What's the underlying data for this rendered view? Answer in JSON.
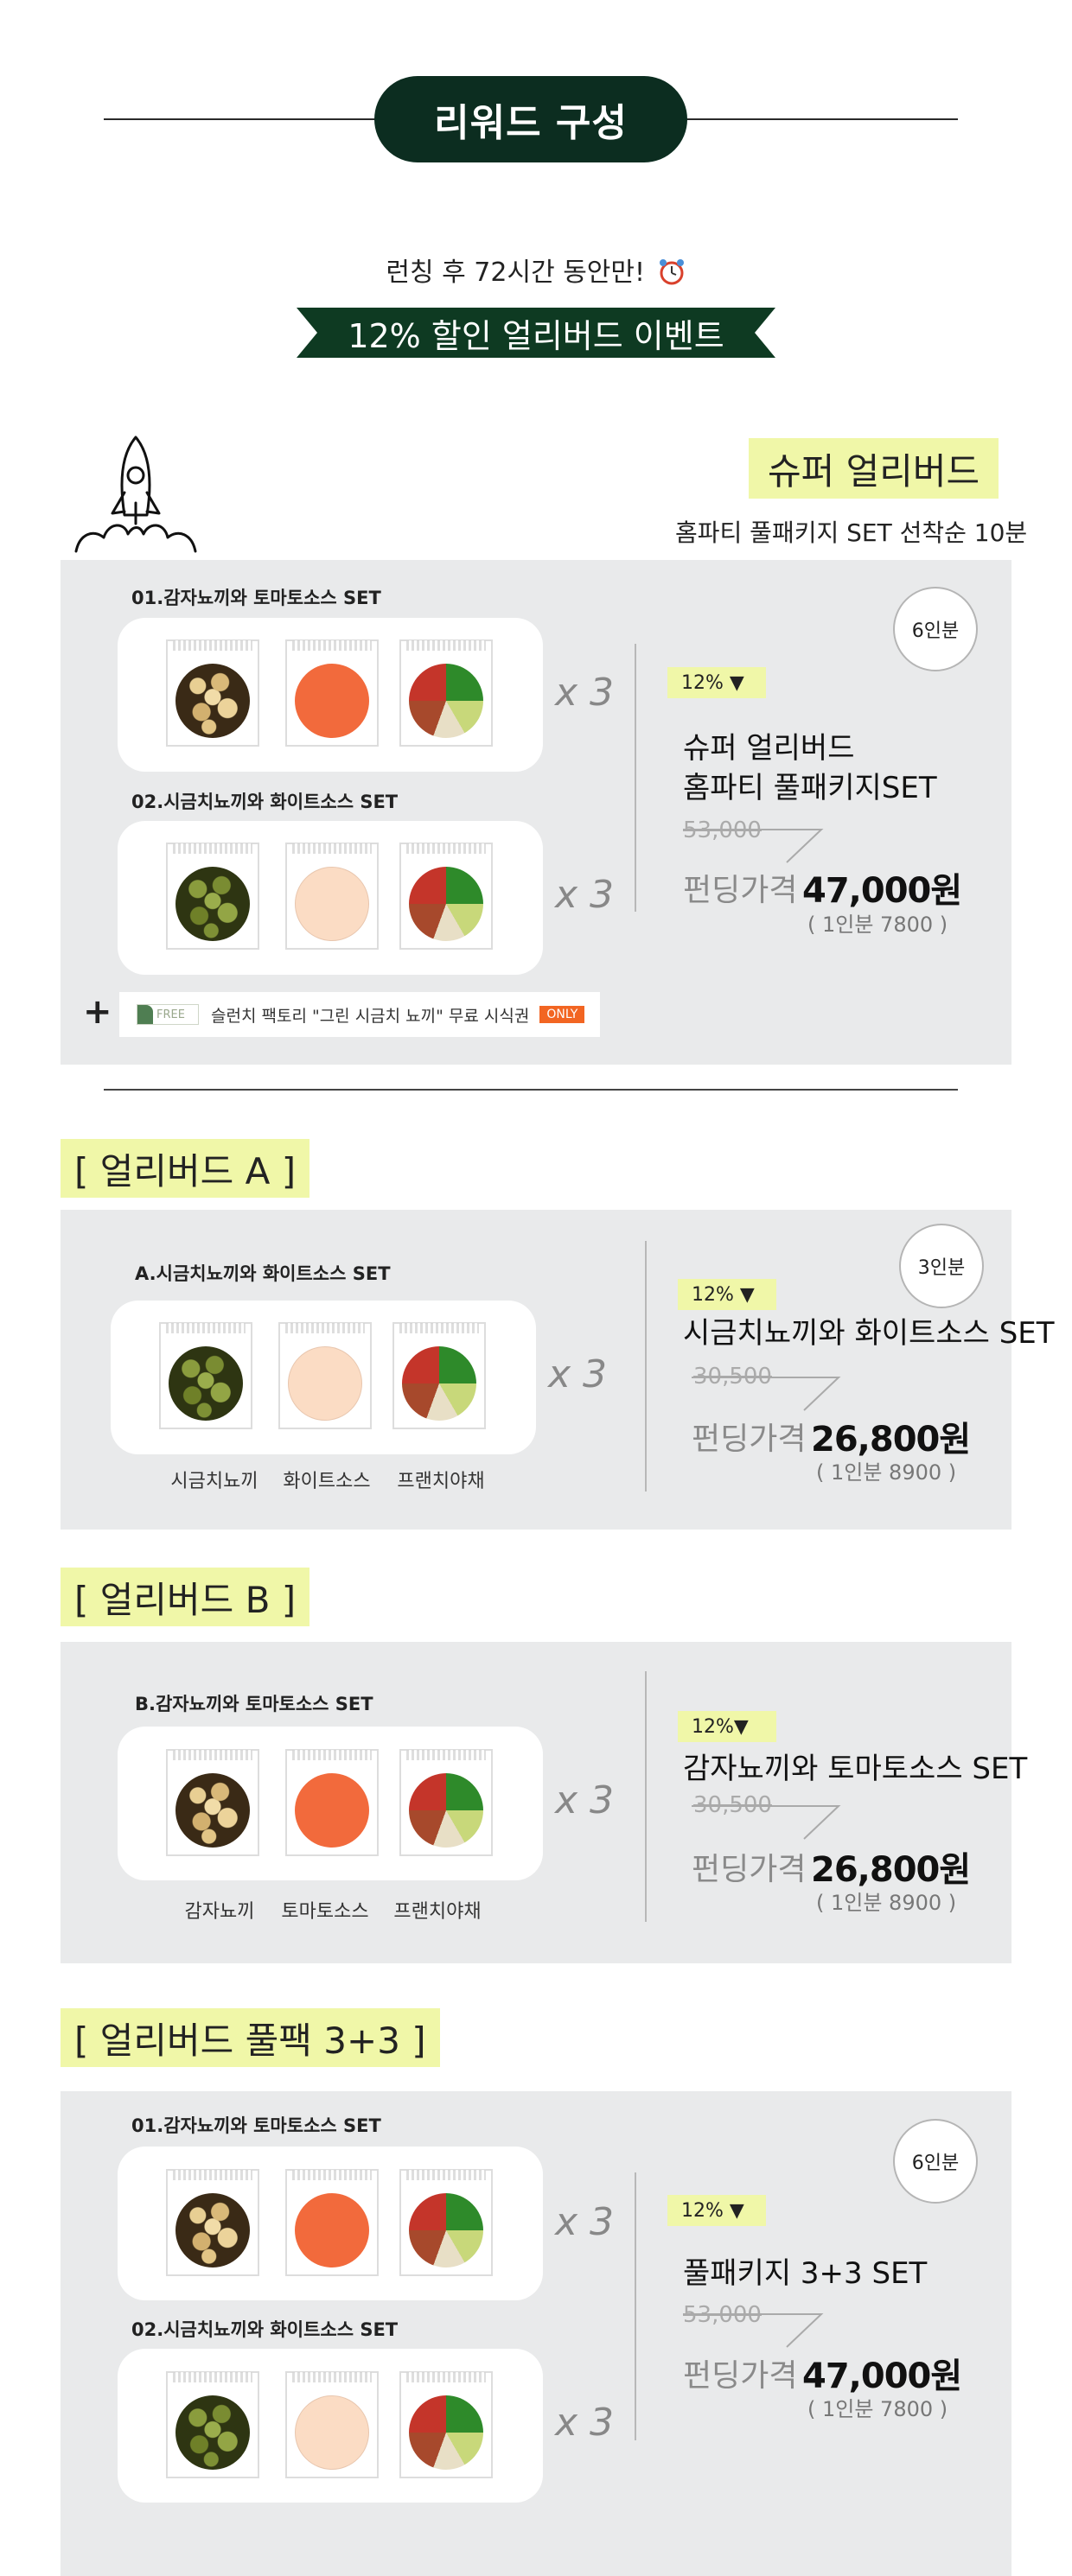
{
  "header": {
    "title": "리워드 구성",
    "promo_line": "런칭 후 72시간 동안만!",
    "ribbon": "12% 할인 얼리버드 이벤트"
  },
  "super": {
    "title": "슈퍼 얼리버드",
    "subtitle": "홈파티 풀패키지 SET 선착순 10분",
    "set1_label": "01.감자뇨끼와 토마토소스 SET",
    "set2_label": "02.시금치뇨끼와 화이트소스 SET",
    "times": "x 3",
    "serving": "6인분",
    "discount": "12% ▼",
    "name_line1": "슈퍼 얼리버드",
    "name_line2": "홈파티 풀패키지SET",
    "original_price": "53,000",
    "funding_label": "펀딩가격",
    "funding_price": "47,000원",
    "per_person": "( 1인분 7800 )",
    "free": {
      "tag": "FREE",
      "text": "슬런치 팩토리 \"그린 시금치 뇨끼\" 무료 시식권",
      "only": "ONLY"
    }
  },
  "a": {
    "heading": "[ 얼리버드 A ]",
    "set_label": "A.시금치뇨끼와 화이트소스 SET",
    "captions": [
      "시금치뇨끼",
      "화이트소스",
      "프랜치야채"
    ],
    "times": "x 3",
    "serving": "3인분",
    "discount": "12% ▼",
    "name": "시금치뇨끼와 화이트소스 SET",
    "original_price": "30,500",
    "funding_label": "펀딩가격",
    "funding_price": "26,800원",
    "per_person": "( 1인분 8900 )"
  },
  "b": {
    "heading": "[ 얼리버드 B ]",
    "set_label": "B.감자뇨끼와 토마토소스 SET",
    "captions": [
      "감자뇨끼",
      "토마토소스",
      "프랜치야채"
    ],
    "times": "x 3",
    "discount": "12%▼",
    "name": "감자뇨끼와 토마토소스 SET",
    "original_price": "30,500",
    "funding_label": "펀딩가격",
    "funding_price": "26,800원",
    "per_person": "( 1인분 8900 )"
  },
  "full": {
    "heading": "[ 얼리버드 풀팩 3+3 ]",
    "set1_label": "01.감자뇨끼와 토마토소스 SET",
    "set2_label": "02.시금치뇨끼와 화이트소스 SET",
    "times": "x 3",
    "serving": "6인분",
    "discount": "12% ▼",
    "name": "풀패키지 3+3 SET",
    "original_price": "53,000",
    "funding_label": "펀딩가격",
    "funding_price": "47,000원",
    "per_person": "( 1인분 7800 )"
  },
  "colors": {
    "pill_bg": "#0c2d20",
    "highlight": "#f0f7a8",
    "panel_bg": "#e9eaeb",
    "tomato": "#f26a3c",
    "only_tag": "#f26522"
  },
  "icons": [
    "rocket-icon",
    "alarm-clock-icon"
  ]
}
